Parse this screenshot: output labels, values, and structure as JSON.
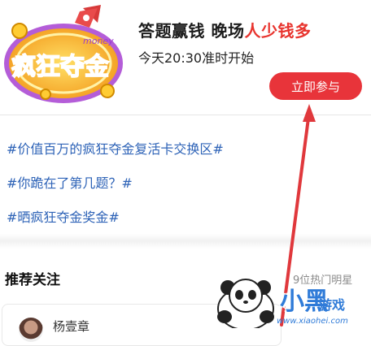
{
  "promo": {
    "logo_text": "疯狂夺金",
    "logo_small_text": "money",
    "title_main": "答题赢钱 晚场",
    "title_highlight": "人少钱多",
    "subtitle": "今天20:30准时开始",
    "join_button": "立即参与"
  },
  "topics": [
    {
      "label": "#价值百万的疯狂夺金复活卡交换区#"
    },
    {
      "label": "#你跪在了第几题？#"
    },
    {
      "label": "#晒疯狂夺金奖金#"
    }
  ],
  "recommend": {
    "title": "推荐关注",
    "count_label": "9位热门明星",
    "cards": [
      {
        "name": "杨壹章"
      }
    ]
  },
  "watermark": {
    "brand_big": "小黑",
    "brand_small": "游戏",
    "url": "www.xiaohei.com"
  },
  "colors": {
    "accent_red": "#e8343a",
    "topic_blue": "#2e63b7",
    "watermark_blue": "#2f7bd8"
  }
}
